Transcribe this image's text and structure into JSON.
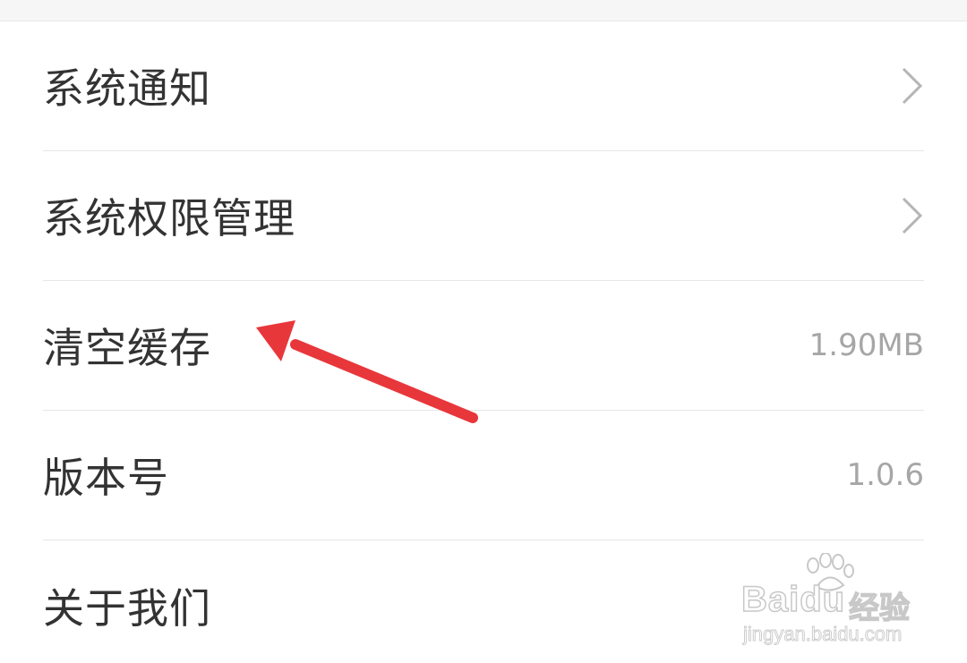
{
  "settings": {
    "items": [
      {
        "label": "系统通知",
        "value": "",
        "chevron": true
      },
      {
        "label": "系统权限管理",
        "value": "",
        "chevron": true
      },
      {
        "label": "清空缓存",
        "value": "1.90MB",
        "chevron": false
      },
      {
        "label": "版本号",
        "value": "1.0.6",
        "chevron": false
      },
      {
        "label": "关于我们",
        "value": "",
        "chevron": false
      }
    ]
  },
  "icons": {
    "chevron": "chevron-right-icon"
  },
  "watermark": {
    "brand": "Baidu",
    "cn": "经验",
    "url": "jingyan.baidu.com"
  },
  "colors": {
    "label": "#333333",
    "value": "#a6a6a6",
    "divider": "#e6e6e6",
    "chevron": "#b5b5b5",
    "arrow": "#e8373b"
  }
}
